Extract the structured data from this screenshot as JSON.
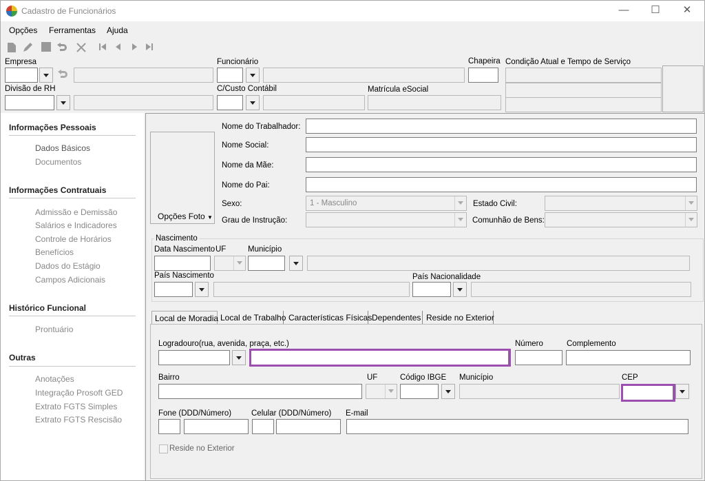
{
  "window": {
    "title": "Cadastro de Funcionários",
    "minimize": "—",
    "maximize": "☐",
    "close": "✕"
  },
  "menu": {
    "items": [
      "Opções",
      "Ferramentas",
      "Ajuda"
    ]
  },
  "toolbar": {
    "icons": [
      "new-document-icon",
      "edit-icon",
      "save-icon",
      "undo-icon",
      "delete-icon",
      "first-record-icon",
      "previous-record-icon",
      "next-record-icon",
      "last-record-icon"
    ]
  },
  "header": {
    "empresa_label": "Empresa",
    "funcionario_label": "Funcionário",
    "chapeira_label": "Chapeira",
    "condicao_label": "Condição Atual e Tempo de Serviço",
    "divisao_label": "Divisão de RH",
    "ccusto_label": "C/Custo Contábil",
    "matricula_label": "Matrícula eSocial"
  },
  "sidebar": {
    "sections": [
      {
        "title": "Informações Pessoais",
        "items": [
          "Dados Básicos",
          "Documentos"
        ]
      },
      {
        "title": "Informações Contratuais",
        "items": [
          "Admissão e Demissão",
          "Salários e Indicadores",
          "Controle de Horários",
          "Benefícios",
          "Dados do Estágio",
          "Campos Adicionais"
        ]
      },
      {
        "title": "Histórico Funcional",
        "items": [
          "Prontuário"
        ]
      },
      {
        "title": "Outras",
        "items": [
          "Anotações",
          "Integração Prosoft GED",
          "Extrato FGTS Simples",
          "Extrato FGTS Rescisão"
        ]
      }
    ],
    "active_item": "Dados Básicos"
  },
  "personal": {
    "photo_button": "Opções Foto",
    "nome_trabalhador": "Nome do Trabalhador:",
    "nome_social": "Nome Social:",
    "nome_mae": "Nome da Mãe:",
    "nome_pai": "Nome do Pai:",
    "sexo_label": "Sexo:",
    "sexo_value": "1 - Masculino",
    "estado_civil_label": "Estado Civil:",
    "grau_label": "Grau de Instrução:",
    "comunhao_label": "Comunhão de Bens:"
  },
  "nascimento": {
    "group": "Nascimento",
    "data_label": "Data Nascimento",
    "uf_label": "UF",
    "municipio_label": "Município",
    "pais_nasc_label": "País Nascimento",
    "pais_nac_label": "País Nacionalidade"
  },
  "tabs": [
    "Local de Moradia",
    "Local de Trabalho",
    "Características Físicas",
    "Dependentes",
    "Reside no Exterior"
  ],
  "moradia": {
    "logradouro_label": "Logradouro(rua, avenida, praça, etc.)",
    "numero_label": "Número",
    "complemento_label": "Complemento",
    "bairro_label": "Bairro",
    "uf_label": "UF",
    "ibge_label": "Código IBGE",
    "municipio_label": "Município",
    "cep_label": "CEP",
    "fone_label": "Fone (DDD/Número)",
    "celular_label": "Celular (DDD/Número)",
    "email_label": "E-mail",
    "reside_label": "Reside no Exterior"
  },
  "colors": {
    "highlight": "#9c4fb0"
  }
}
